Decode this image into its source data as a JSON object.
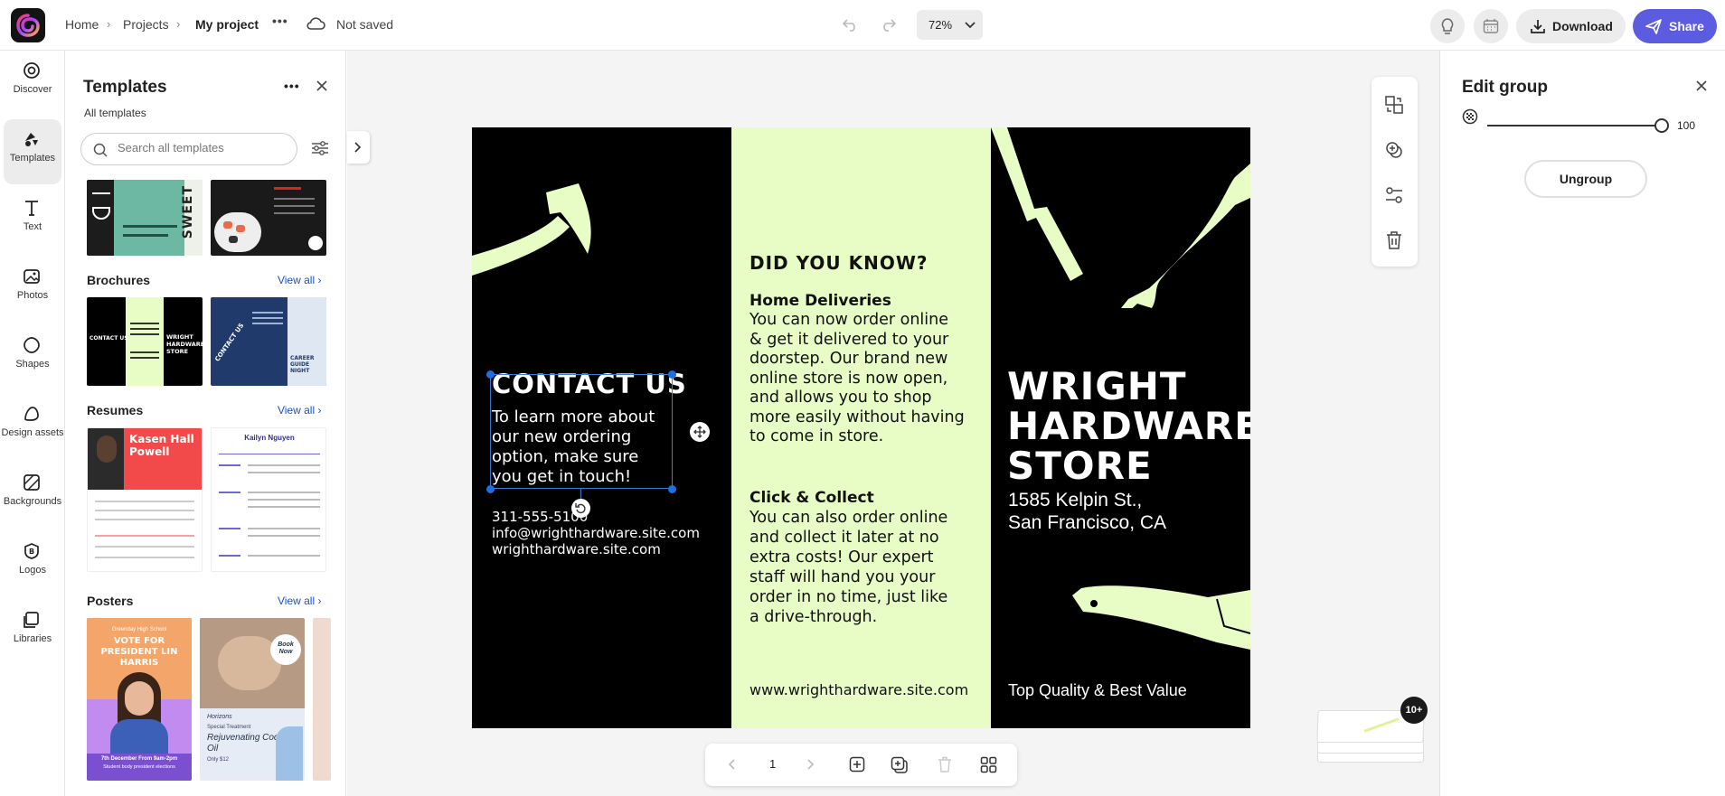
{
  "topbar": {
    "breadcrumb": [
      "Home",
      "Projects",
      "My project"
    ],
    "more_label": "•••",
    "save_status": "Not saved",
    "zoom": "72%",
    "download_label": "Download",
    "share_label": "Share"
  },
  "rail": {
    "items": [
      {
        "label": "Discover",
        "icon": "discover-icon"
      },
      {
        "label": "Templates",
        "icon": "templates-icon"
      },
      {
        "label": "Text",
        "icon": "text-icon"
      },
      {
        "label": "Photos",
        "icon": "photos-icon"
      },
      {
        "label": "Shapes",
        "icon": "shapes-icon"
      },
      {
        "label": "Design assets",
        "icon": "design-assets-icon"
      },
      {
        "label": "Backgrounds",
        "icon": "backgrounds-icon"
      },
      {
        "label": "Logos",
        "icon": "logos-icon"
      },
      {
        "label": "Libraries",
        "icon": "libraries-icon"
      }
    ]
  },
  "panel": {
    "title": "Templates",
    "subtitle": "All templates",
    "search_placeholder": "Search all templates",
    "view_all": "View all",
    "sections": {
      "brochures": "Brochures",
      "resumes": "Resumes",
      "posters": "Posters"
    },
    "thumbs": {
      "sweet": "SWEET",
      "contact_us": "CONTACT US",
      "wright_store": "WRIGHT HARDWARE STORE",
      "contact_us_2": "CONTACT US",
      "career_guide": "CAREER GUIDE NIGHT",
      "resume_name_1": "Kasen Hall Powell",
      "resume_name_2": "Kailyn Nguyen",
      "poster_school": "Greenday High School",
      "poster_vote": "VOTE FOR PRESIDENT LIN HARRIS",
      "poster_date": "7th December From 9am-2pm",
      "poster_elections": "Student body president elections",
      "poster_book": "Book Now",
      "poster_brand": "Horizons",
      "poster_special": "Special Treatment",
      "poster_product": "Rejuvenating Coconut Oil",
      "poster_price": "Only $12"
    }
  },
  "brochure": {
    "contact_title": "CONTACT US",
    "contact_body": [
      "To learn more about",
      "our new ordering",
      "option, make sure",
      "you get in touch!"
    ],
    "phone": "311-555-5100",
    "email": "info@wrighthardware.site.com",
    "web_left": "wrighthardware.site.com",
    "did_you_know": "DID YOU KNOW?",
    "home_deliveries_title": "Home Deliveries",
    "home_deliveries_body": [
      "You can now order online",
      "& get it delivered to your",
      "doorstep. Our brand new",
      "online store is now open,",
      "and allows you to shop",
      "more easily without having",
      "to come in store."
    ],
    "click_collect_title": "Click & Collect",
    "click_collect_body": [
      "You can also order online",
      "and collect it later at no",
      "extra costs! Our expert",
      "staff will hand you your",
      "order in no time, just like",
      "a drive-through."
    ],
    "web_middle": "www.wrighthardware.site.com",
    "store_name": [
      "WRIGHT",
      "HARDWARE",
      "STORE"
    ],
    "address": [
      "1585 Kelpin St.,",
      "San Francisco, CA"
    ],
    "tagline": "Top Quality & Best Value",
    "colors": {
      "accent": "#e8fcc5",
      "dark": "#000000"
    }
  },
  "editpanel": {
    "title": "Edit group",
    "opacity_value": "100",
    "opacity_level": 1.0,
    "ungroup_label": "Ungroup"
  },
  "pagebar": {
    "page_number": "1",
    "badge": "10+"
  }
}
